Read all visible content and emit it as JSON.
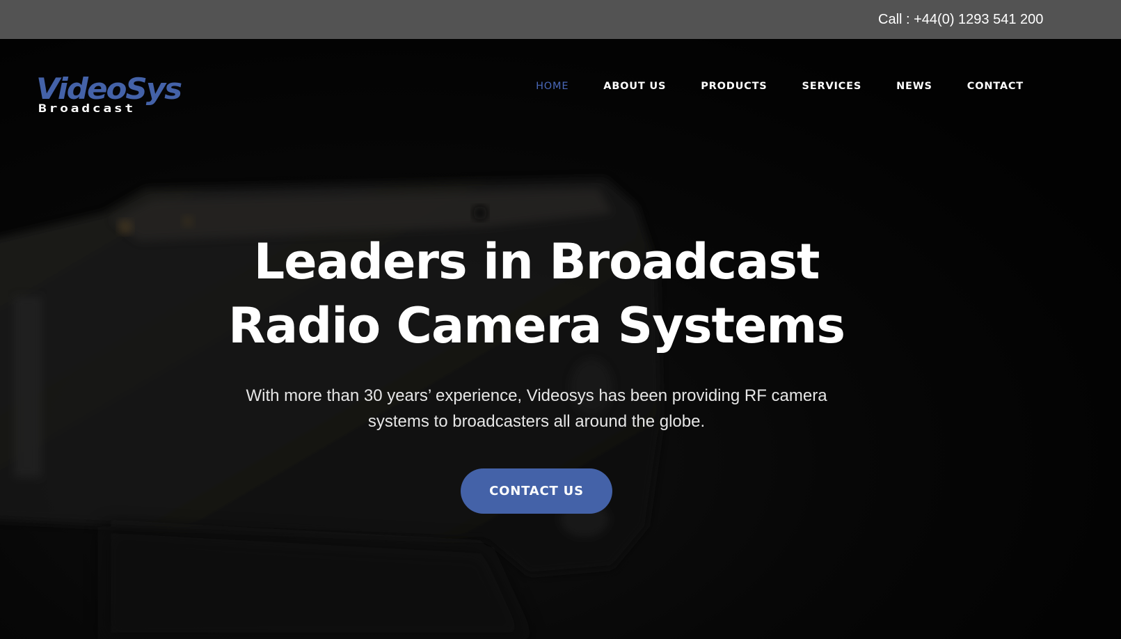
{
  "topbar": {
    "call_text": "Call : +44(0) 1293 541 200"
  },
  "brand": {
    "logo_main": "VideoSys",
    "logo_sub": "Broadcast",
    "logo_color": "#4462a8"
  },
  "nav": {
    "items": [
      {
        "label": "HOME",
        "active": true
      },
      {
        "label": "ABOUT US",
        "active": false
      },
      {
        "label": "PRODUCTS",
        "active": false
      },
      {
        "label": "SERVICES",
        "active": false
      },
      {
        "label": "NEWS",
        "active": false
      },
      {
        "label": "CONTACT",
        "active": false
      }
    ],
    "active_color": "#4a68b8"
  },
  "hero": {
    "title_line1": "Leaders in Broadcast",
    "title_line2": "Radio Camera Systems",
    "subtitle_line1": "With more than 30 years’ experience, Videosys has been providing RF camera",
    "subtitle_line2": "systems to broadcasters all around the globe.",
    "cta_label": "CONTACT US",
    "cta_color": "#4462a8",
    "background_image": "camera-image"
  }
}
